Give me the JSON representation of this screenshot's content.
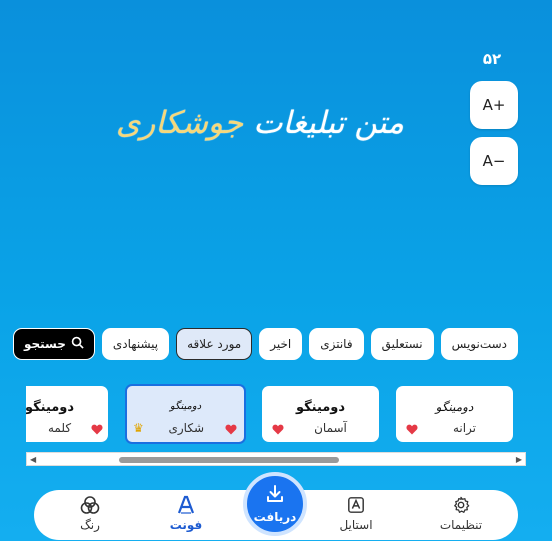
{
  "font_size": {
    "value": "۵۲",
    "increase_label": "A+",
    "decrease_label": "A−"
  },
  "preview": {
    "text_main": "متن تبلیغات",
    "text_accent": "جوشکاری"
  },
  "chips": {
    "search": "جستجو",
    "items": [
      "پیشنهادی",
      "مورد علاقه",
      "اخیر",
      "فانتزی",
      "نستعلیق",
      "دست‌نویس"
    ],
    "selected": "مورد علاقه"
  },
  "cards": [
    {
      "sample": "دومینگو",
      "name": "ترانه",
      "style": "thin"
    },
    {
      "sample": "دومینگو",
      "name": "آسمان",
      "style": "bold"
    },
    {
      "sample": "دومینگو",
      "name": "شکاری",
      "style": "thin",
      "selected": true,
      "premium": true
    },
    {
      "sample": "دومینگو",
      "name": "کلمه",
      "style": "bold"
    }
  ],
  "colors": {
    "accent": "#1a74f0",
    "heart": "#e53946",
    "crown": "#e0a400"
  },
  "nav": {
    "settings": "تنظیمات",
    "style": "استایل",
    "download": "دریافت",
    "font": "فونت",
    "color": "رنگ"
  }
}
